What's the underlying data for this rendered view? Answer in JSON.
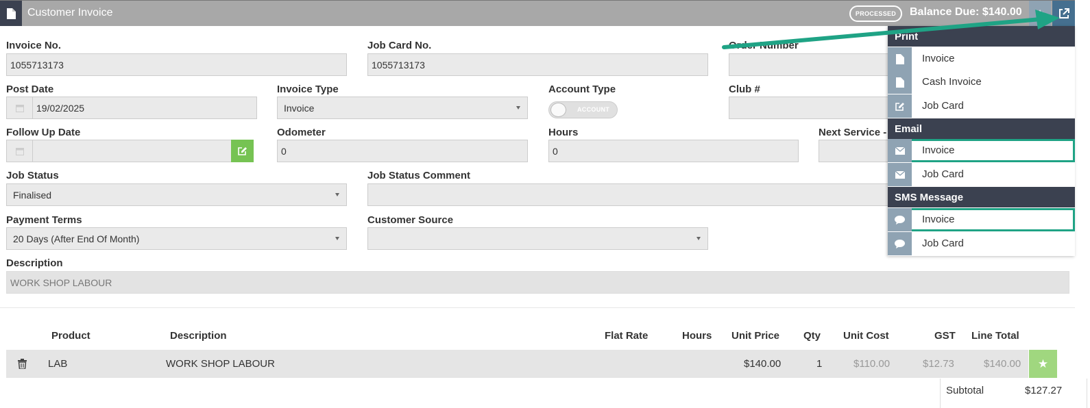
{
  "header": {
    "title": "Customer Invoice",
    "status_badge": "PROCESSED",
    "balance_due": "Balance Due: $140.00"
  },
  "form": {
    "invoice_no": {
      "label": "Invoice No.",
      "value": "1055713173"
    },
    "job_card_no": {
      "label": "Job Card No.",
      "value": "1055713173"
    },
    "order_number": {
      "label": "Order Number",
      "value": ""
    },
    "post_date": {
      "label": "Post Date",
      "value": "19/02/2025"
    },
    "invoice_type": {
      "label": "Invoice Type",
      "value": "Invoice"
    },
    "account_type": {
      "label": "Account Type",
      "toggle_text": "ACCOUNT"
    },
    "club_no": {
      "label": "Club #",
      "value": ""
    },
    "follow_up_date": {
      "label": "Follow Up Date",
      "value": ""
    },
    "odometer": {
      "label": "Odometer",
      "value": "0"
    },
    "hours": {
      "label": "Hours",
      "value": "0"
    },
    "next_service": {
      "label": "Next Service -",
      "value": ""
    },
    "job_status": {
      "label": "Job Status",
      "value": "Finalised"
    },
    "job_status_comment": {
      "label": "Job Status Comment",
      "value": ""
    },
    "payment_terms": {
      "label": "Payment Terms",
      "value": "20 Days (After End Of Month)"
    },
    "customer_source": {
      "label": "Customer Source",
      "value": ""
    },
    "description": {
      "label": "Description",
      "value": "WORK SHOP LABOUR"
    }
  },
  "table": {
    "columns": [
      "Product",
      "Description",
      "Flat Rate",
      "Hours",
      "Unit Price",
      "Qty",
      "Unit Cost",
      "GST",
      "Line Total"
    ],
    "rows": [
      {
        "product": "LAB",
        "description": "WORK SHOP LABOUR",
        "flat_rate": "",
        "hours": "",
        "unit_price": "$140.00",
        "qty": "1",
        "unit_cost": "$110.00",
        "gst": "$12.73",
        "line_total": "$140.00"
      }
    ],
    "subtotal_label": "Subtotal",
    "subtotal_value": "$127.27"
  },
  "menu": {
    "print": {
      "heading": "Print",
      "items": [
        "Invoice",
        "Cash Invoice",
        "Job Card"
      ]
    },
    "email": {
      "heading": "Email",
      "items": [
        "Invoice",
        "Job Card"
      ]
    },
    "sms": {
      "heading": "SMS Message",
      "items": [
        "Invoice",
        "Job Card"
      ]
    }
  },
  "colors": {
    "header_bg": "#a8a8a8",
    "dark_navy": "#3b4150",
    "icon_slate": "#8fa3b3",
    "active_blue": "#456f8f",
    "green": "#76c353",
    "highlight_teal": "#1fa385"
  }
}
